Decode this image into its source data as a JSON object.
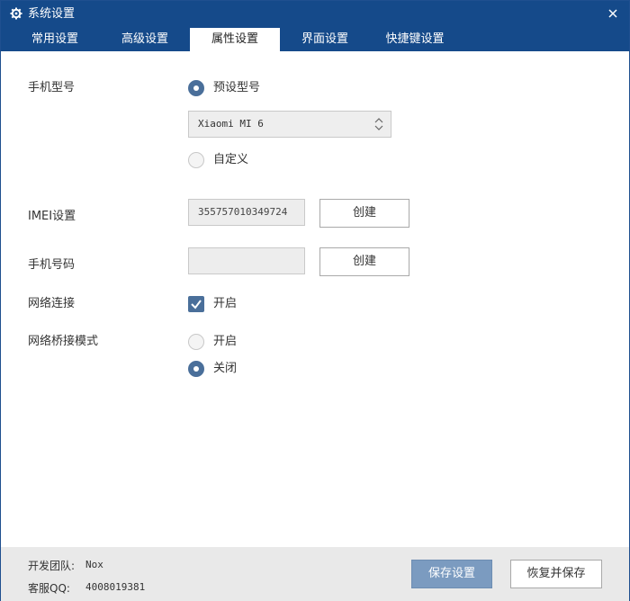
{
  "window": {
    "title": "系统设置",
    "title_icon": "gear-icon",
    "close_icon": "close-icon"
  },
  "tabs": [
    {
      "label": "常用设置",
      "active": false
    },
    {
      "label": "高级设置",
      "active": false
    },
    {
      "label": "属性设置",
      "active": true
    },
    {
      "label": "界面设置",
      "active": false
    },
    {
      "label": "快捷键设置",
      "active": false
    }
  ],
  "phone_model": {
    "label": "手机型号",
    "preset_label": "预设型号",
    "preset_selected": true,
    "selected_model": "Xiaomi  MI 6",
    "custom_label": "自定义",
    "custom_selected": false
  },
  "imei": {
    "label": "IMEI设置",
    "value": "355757010349724",
    "create_label": "创建"
  },
  "phone_number": {
    "label": "手机号码",
    "value": "",
    "create_label": "创建"
  },
  "network": {
    "label": "网络连接",
    "checkbox_label": "开启",
    "checked": true
  },
  "bridge_mode": {
    "label": "网络桥接模式",
    "on_label": "开启",
    "on_selected": false,
    "off_label": "关闭",
    "off_selected": true
  },
  "footer": {
    "team_label": "开发团队:",
    "team_value": "Nox",
    "qq_label": "客服QQ:",
    "qq_value": "4008019381",
    "save_label": "保存设置",
    "restore_label": "恢复并保存"
  },
  "colors": {
    "titlebar": "#154a8a",
    "accent": "#4a6f9a",
    "save_button": "#7b9bc0",
    "footer_bg": "#e9e9e9"
  }
}
